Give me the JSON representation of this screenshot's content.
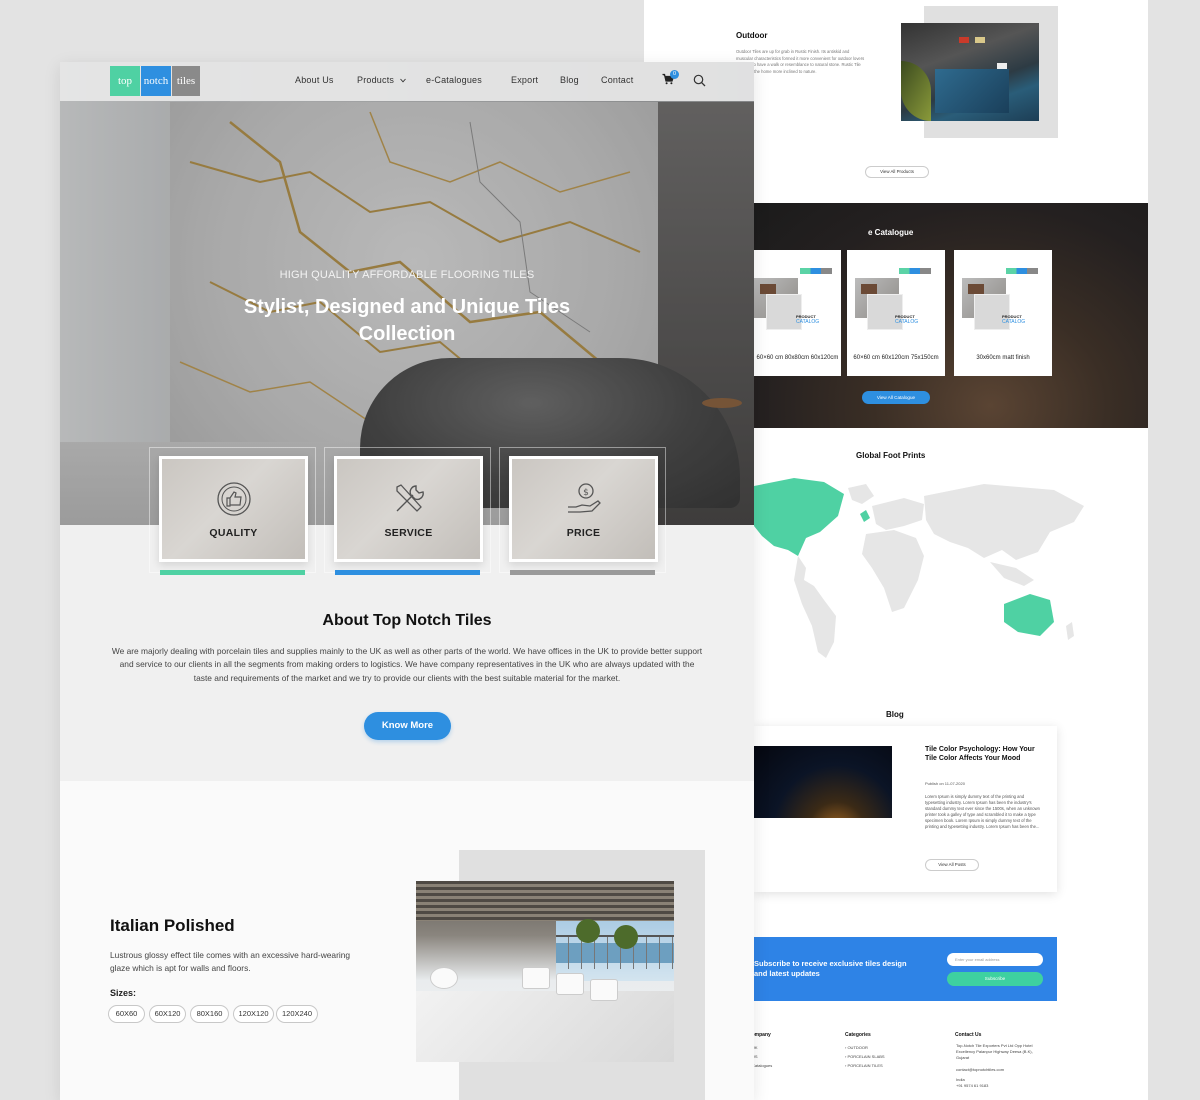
{
  "back": {
    "outdoor": {
      "title": "Outdoor",
      "text": "Outdoor Tiles are up for grab in Rustic Finish. Its antiskid and muscular characteristics formed it more convenient for outdoor lovers who like to have a walk or resemblance to natural stone. Rustic Tile makes of the home more inclined to nature."
    },
    "view_all_products": "View All Products",
    "catalogue": {
      "title": "e Catalogue",
      "cards": [
        {
          "caption": "60×60 cm 80x80cm 60x120cm",
          "product": "PRODUCT",
          "catalog": "CATALOG"
        },
        {
          "caption": "60×60 cm 60x120cm 75x150cm",
          "product": "PRODUCT",
          "catalog": "CATALOG"
        },
        {
          "caption": "30x60cm matt finish",
          "product": "PRODUCT",
          "catalog": "CATALOG"
        }
      ],
      "button": "View All Catalogue"
    },
    "global": {
      "title": "Global Foot Prints"
    },
    "blog": {
      "title": "Blog",
      "post_title": "Tile Color Psychology: How Your Tile Color Affects Your Mood",
      "post_date": "Publish on 11-07-2020",
      "post_text": "Lorem Ipsum is simply dummy text of the printing and typesetting industry. Lorem Ipsum has been the industry's standard dummy text ever since the 1500s, when an unknown printer took a galley of type and scrambled it to make a type specimen book. Lorem Ipsum is simply dummy text of the printing and typesetting industry. Lorem Ipsum has been the...",
      "button": "View All Posts"
    },
    "subscribe": {
      "text": "Subscribe to receive exclusive tiles design and latest updates",
      "placeholder": "Enter your email address",
      "button": "Subscribe"
    },
    "footer": {
      "col1_title": "Company",
      "col1_items": [
        "UK",
        "US",
        "Catalogues"
      ],
      "col2_title": "Categories",
      "col2_items": [
        "› OUTDOOR",
        "› PORCELAIN SLABS",
        "› PORCELAIN TILES"
      ],
      "col3_title": "Contact Us",
      "address": "Top-Notch Tile Exporters Pvt Ltd Opp Hotel Excellency Palanpur Highway Deesa (B.K), Gujarat",
      "email": "contact@topnotchtiles.com",
      "phone_country": "India",
      "phone": "+91 9574 61 9183"
    }
  },
  "front": {
    "logo": {
      "part1": "top",
      "part2": "notch",
      "part3": "tiles"
    },
    "nav": {
      "about": "About Us",
      "products": "Products",
      "catalogues": "e-Catalogues",
      "export": "Export",
      "blog": "Blog",
      "contact": "Contact"
    },
    "cart_count": "0",
    "hero": {
      "subtitle": "HIGH QUALITY AFFORDABLE FLOORING TILES",
      "title": "Stylist, Designed and Unique Tiles Collection"
    },
    "features": [
      {
        "label": "QUALITY",
        "icon": "thumbs-up-icon",
        "bar_color": "#4fd1a3"
      },
      {
        "label": "SERVICE",
        "icon": "tools-icon",
        "bar_color": "#2e8fe0"
      },
      {
        "label": "PRICE",
        "icon": "money-hand-icon",
        "bar_color": "#9a9a9a"
      }
    ],
    "about": {
      "title": "About Top Notch Tiles",
      "text": "We are majorly dealing with porcelain tiles and supplies mainly to the UK as well as other parts of the world. We have offices in the UK to provide better support and service to our clients in all the segments from making orders to logistics. We have company representatives in the UK who are always updated with the taste and requirements of the market and we try to provide our clients with the best suitable material for the market.",
      "button": "Know More"
    },
    "italian": {
      "title": "Italian Polished",
      "text": "Lustrous glossy effect tile comes with an excessive hard-wearing glaze which is apt for walls and floors.",
      "sizes_label": "Sizes:",
      "sizes": [
        "60X60",
        "60X120",
        "80X160",
        "120X120",
        "120X240"
      ]
    }
  },
  "colors": {
    "accent_blue": "#2e8fe0",
    "accent_green": "#4fd1a3",
    "logo_gray": "#8a8a8a"
  }
}
